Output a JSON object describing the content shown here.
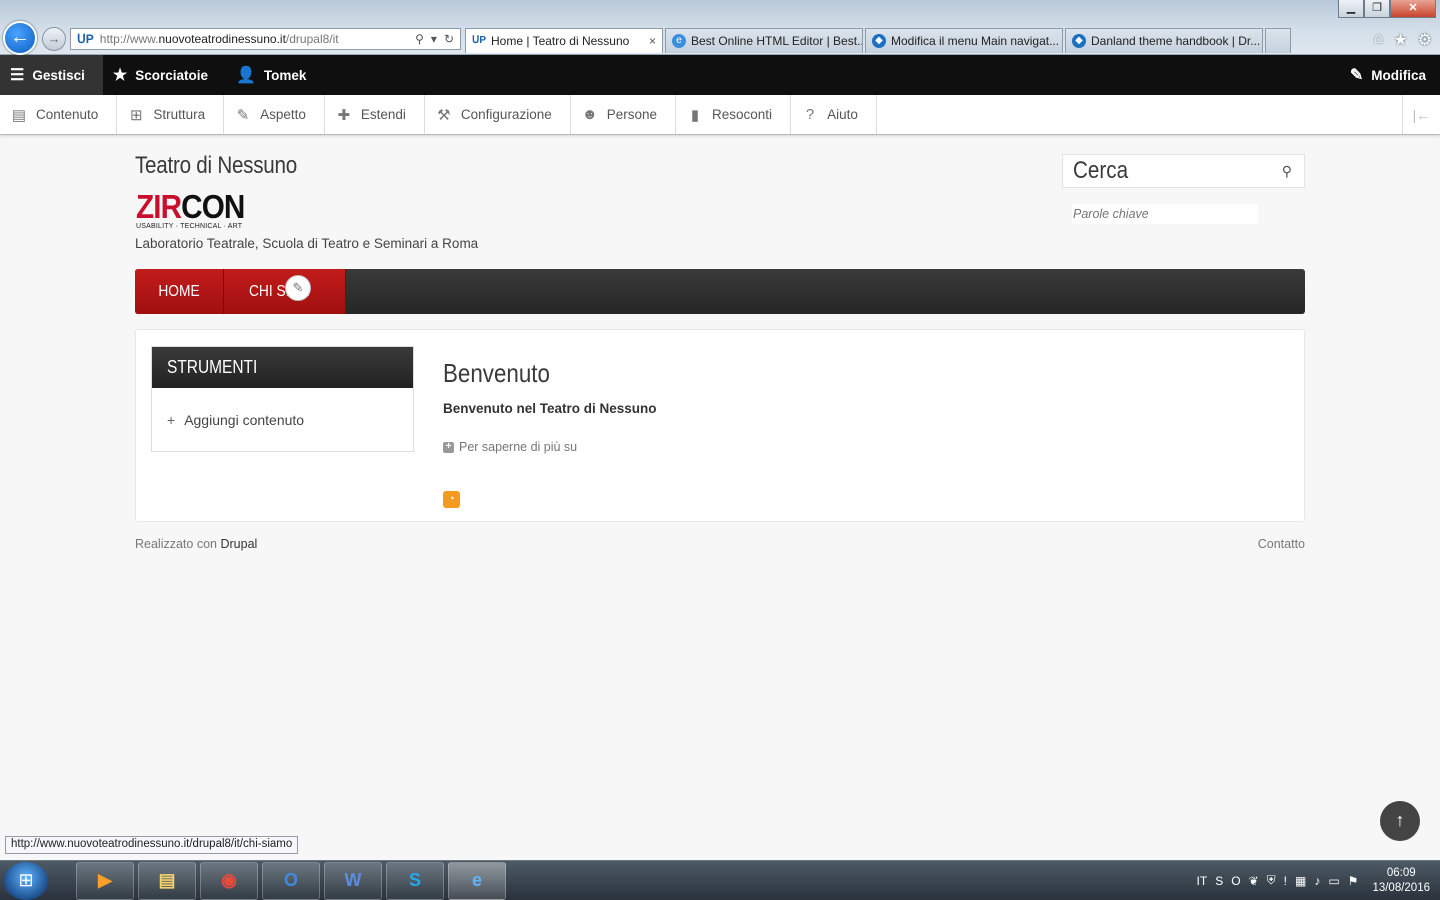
{
  "browser": {
    "address_url_prefix": "http://www.",
    "address_url_domain": "nuovoteatrodinessuno.it",
    "address_url_path": "/drupal8/it",
    "site_icon": "ᑌP",
    "tabs": [
      {
        "label": "Home | Teatro di Nessuno",
        "icon": "drupal-site-icon",
        "active": true,
        "close": "×"
      },
      {
        "label": "Best Online HTML Editor | Best...",
        "icon": "ie-icon"
      },
      {
        "label": "Modifica il menu Main navigat...",
        "icon": "drupal-icon"
      },
      {
        "label": "Danland theme handbook | Dr...",
        "icon": "drupal-icon"
      }
    ],
    "status_url": "http://www.nuovoteatrodinessuno.it/drupal8/it/chi-siamo"
  },
  "toolbar": {
    "manage_label": "Gestisci",
    "shortcuts_label": "Scorciatoie",
    "user_label": "Tomek",
    "edit_label": "Modifica"
  },
  "tray": {
    "items": [
      {
        "label": "Contenuto",
        "icon": "file-icon",
        "glyph": "▤"
      },
      {
        "label": "Struttura",
        "icon": "sitemap-icon",
        "glyph": "⊞"
      },
      {
        "label": "Aspetto",
        "icon": "paintbrush-icon",
        "glyph": "✎"
      },
      {
        "label": "Estendi",
        "icon": "puzzle-icon",
        "glyph": "✚"
      },
      {
        "label": "Configurazione",
        "icon": "wrench-icon",
        "glyph": "⚒"
      },
      {
        "label": "Persone",
        "icon": "people-icon",
        "glyph": "☻"
      },
      {
        "label": "Resoconti",
        "icon": "bar-chart-icon",
        "glyph": "▮"
      },
      {
        "label": "Aiuto",
        "icon": "help-icon",
        "glyph": "?"
      }
    ]
  },
  "site": {
    "name": "Teatro di Nessuno",
    "logo_red": "ZIR",
    "logo_black": "CON",
    "logo_sub": "USABILITY · TECHNICAL · ART",
    "slogan": "Laboratorio Teatrale, Scuola di Teatro e Seminari a Roma"
  },
  "search": {
    "title": "Cerca",
    "placeholder": "Parole chiave"
  },
  "main_nav": {
    "items": [
      "HOME",
      "CHI SIAM"
    ]
  },
  "sidebar": {
    "title": "STRUMENTI",
    "link_plus": "+",
    "link_label": "Aggiungi contenuto"
  },
  "article": {
    "title": "Benvenuto",
    "body": "Benvenuto nel Teatro di Nessuno",
    "read_more": "Per saperne di più su"
  },
  "footer": {
    "powered_prefix": "Realizzato con",
    "powered_link": "Drupal",
    "contact": "Contatto"
  },
  "taskbar": {
    "language": "IT",
    "time": "06:09",
    "date": "13/08/2016"
  },
  "colors": {
    "accent_red": "#c21c1c",
    "toolbar_black": "#0f0f0f",
    "nav_dark": "#2e2e2e"
  }
}
